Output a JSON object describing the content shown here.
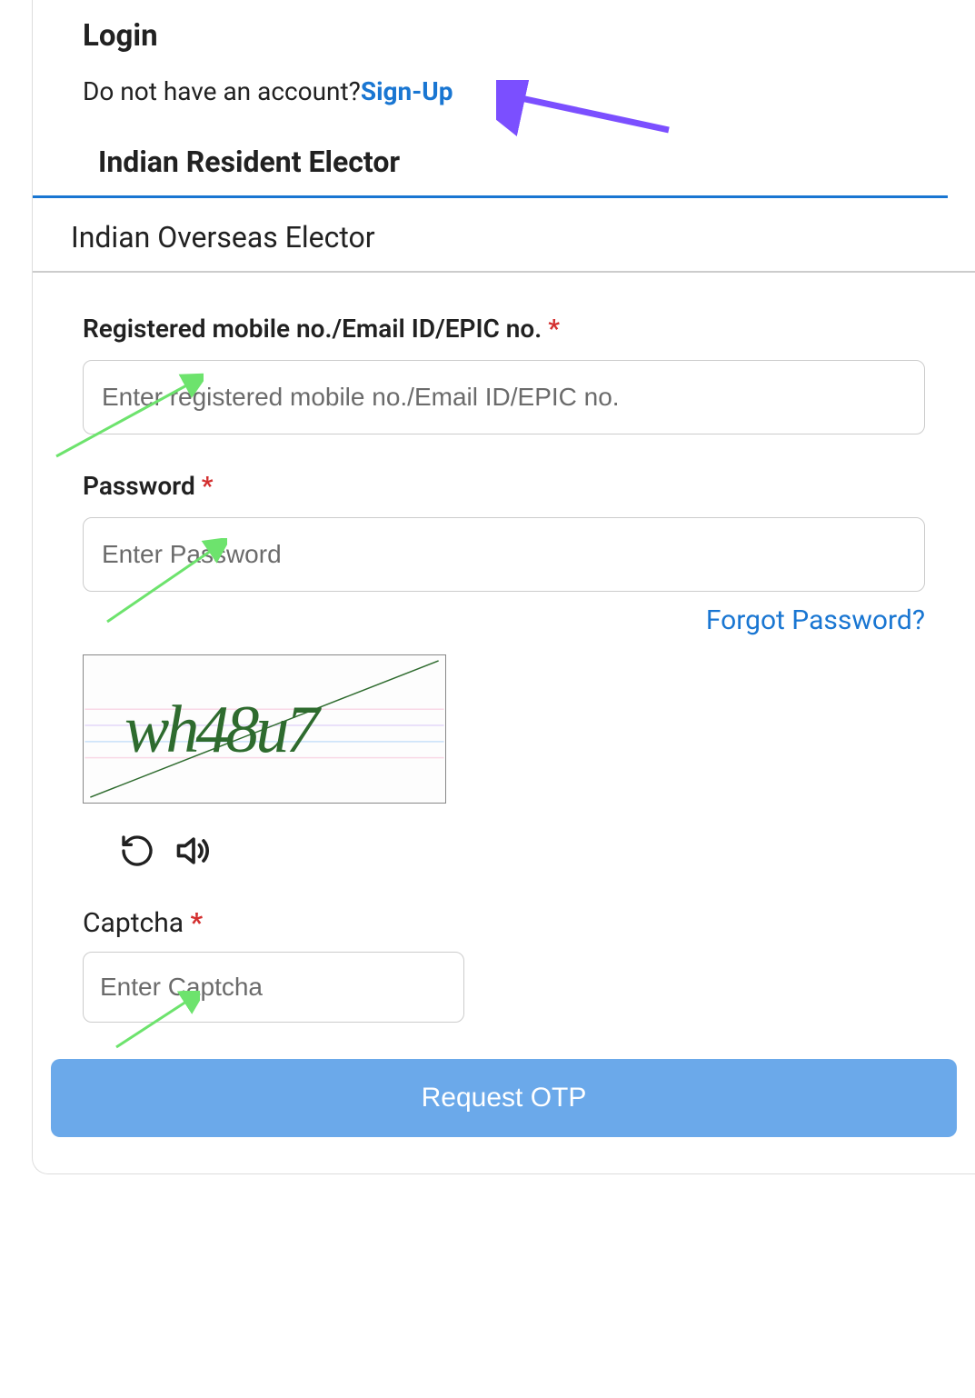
{
  "header": {
    "title": "Login",
    "signup_prompt": "Do not have an account?",
    "signup_link": "Sign-Up"
  },
  "tabs": {
    "active": "Indian Resident Elector",
    "inactive": "Indian Overseas Elector"
  },
  "form": {
    "identifier": {
      "label": "Registered mobile no./Email ID/EPIC no.",
      "placeholder": "Enter registered mobile no./Email ID/EPIC no."
    },
    "password": {
      "label": "Password",
      "placeholder": "Enter Password"
    },
    "forgot_link": "Forgot Password?",
    "captcha": {
      "label": "Captcha",
      "placeholder": "Enter Captcha",
      "value_shown": "wh48u7"
    },
    "submit_button": "Request OTP"
  }
}
